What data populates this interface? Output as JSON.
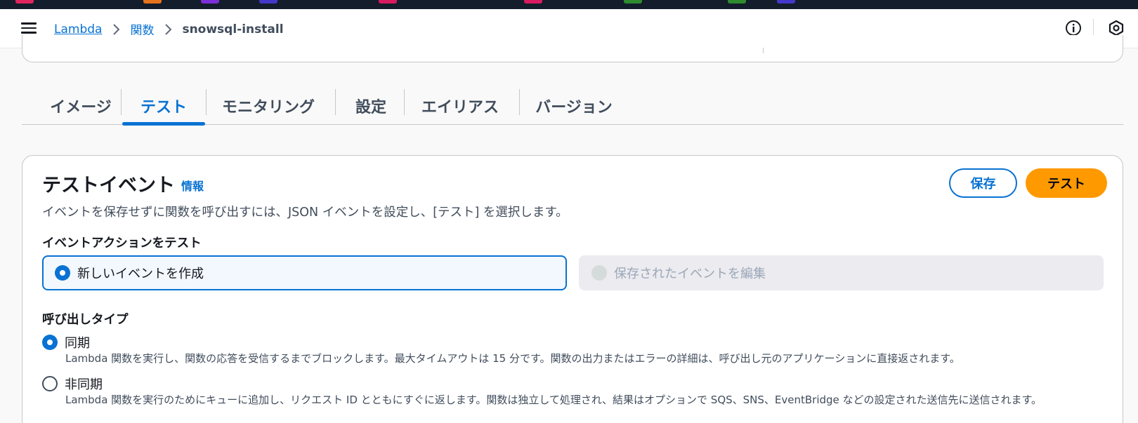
{
  "colors": {
    "accent": "#0972d3",
    "primary_button": "#ff9900",
    "header_bg": "#ffffff",
    "page_bg": "#f9f9f9",
    "browser_strip": "#141d2b",
    "strip_blocks": [
      "#e0245e",
      "#e8731c",
      "#7b2fd6",
      "#4338ca",
      "#d81b60",
      "#d81b60",
      "#2e8b2e",
      "#2e8b2e",
      "#4338ca"
    ]
  },
  "header": {
    "menu_icon": "hamburger-icon",
    "breadcrumb": {
      "items": [
        "Lambda",
        "関数"
      ],
      "current": "snowsql-install"
    },
    "icons": [
      "info-icon",
      "settings-hex-icon"
    ]
  },
  "tabs": [
    {
      "label": "イメージ",
      "active": false
    },
    {
      "label": "テスト",
      "active": true
    },
    {
      "label": "モニタリング",
      "active": false
    },
    {
      "label": "設定",
      "active": false
    },
    {
      "label": "エイリアス",
      "active": false
    },
    {
      "label": "バージョン",
      "active": false
    }
  ],
  "test_event": {
    "title": "テストイベント",
    "info_link": "情報",
    "description": "イベントを保存せずに関数を呼び出すには、JSON イベントを設定し、[テスト] を選択します。",
    "save_button": "保存",
    "test_button": "テスト",
    "action_label": "イベントアクションをテスト",
    "action_options": [
      {
        "label": "新しいイベントを作成",
        "selected": true,
        "disabled": false
      },
      {
        "label": "保存されたイベントを編集",
        "selected": false,
        "disabled": true
      }
    ],
    "invocation_label": "呼び出しタイプ",
    "invocation_options": [
      {
        "label": "同期",
        "selected": true,
        "description": "Lambda 関数を実行し、関数の応答を受信するまでブロックします。最大タイムアウトは 15 分です。関数の出力またはエラーの詳細は、呼び出し元のアプリケーションに直接返されます。"
      },
      {
        "label": "非同期",
        "selected": false,
        "description": "Lambda 関数を実行のためにキューに追加し、リクエスト ID とともにすぐに返します。関数は独立して処理され、結果はオプションで SQS、SNS、EventBridge などの設定された送信先に送信されます。"
      }
    ]
  }
}
